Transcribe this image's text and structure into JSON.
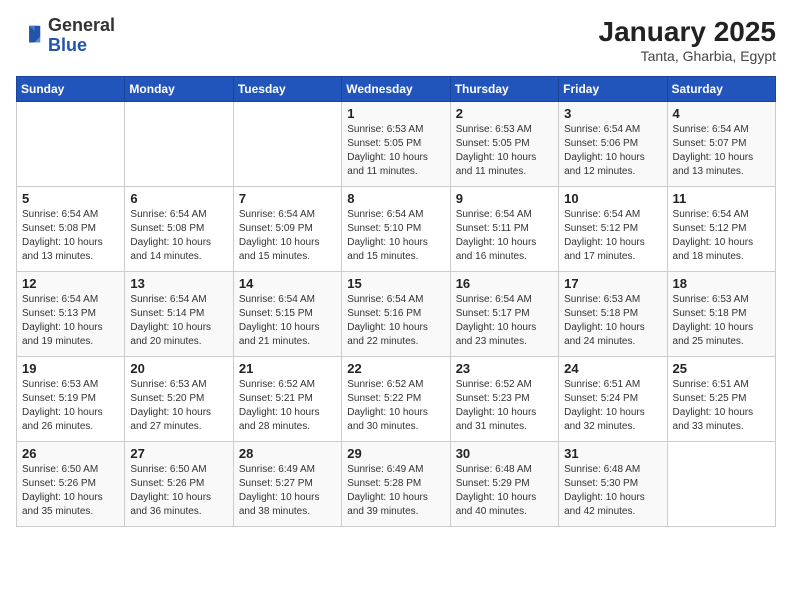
{
  "header": {
    "logo_general": "General",
    "logo_blue": "Blue",
    "month": "January 2025",
    "location": "Tanta, Gharbia, Egypt"
  },
  "days_of_week": [
    "Sunday",
    "Monday",
    "Tuesday",
    "Wednesday",
    "Thursday",
    "Friday",
    "Saturday"
  ],
  "weeks": [
    [
      {
        "day": "",
        "info": ""
      },
      {
        "day": "",
        "info": ""
      },
      {
        "day": "",
        "info": ""
      },
      {
        "day": "1",
        "info": "Sunrise: 6:53 AM\nSunset: 5:05 PM\nDaylight: 10 hours\nand 11 minutes."
      },
      {
        "day": "2",
        "info": "Sunrise: 6:53 AM\nSunset: 5:05 PM\nDaylight: 10 hours\nand 11 minutes."
      },
      {
        "day": "3",
        "info": "Sunrise: 6:54 AM\nSunset: 5:06 PM\nDaylight: 10 hours\nand 12 minutes."
      },
      {
        "day": "4",
        "info": "Sunrise: 6:54 AM\nSunset: 5:07 PM\nDaylight: 10 hours\nand 13 minutes."
      }
    ],
    [
      {
        "day": "5",
        "info": "Sunrise: 6:54 AM\nSunset: 5:08 PM\nDaylight: 10 hours\nand 13 minutes."
      },
      {
        "day": "6",
        "info": "Sunrise: 6:54 AM\nSunset: 5:08 PM\nDaylight: 10 hours\nand 14 minutes."
      },
      {
        "day": "7",
        "info": "Sunrise: 6:54 AM\nSunset: 5:09 PM\nDaylight: 10 hours\nand 15 minutes."
      },
      {
        "day": "8",
        "info": "Sunrise: 6:54 AM\nSunset: 5:10 PM\nDaylight: 10 hours\nand 15 minutes."
      },
      {
        "day": "9",
        "info": "Sunrise: 6:54 AM\nSunset: 5:11 PM\nDaylight: 10 hours\nand 16 minutes."
      },
      {
        "day": "10",
        "info": "Sunrise: 6:54 AM\nSunset: 5:12 PM\nDaylight: 10 hours\nand 17 minutes."
      },
      {
        "day": "11",
        "info": "Sunrise: 6:54 AM\nSunset: 5:12 PM\nDaylight: 10 hours\nand 18 minutes."
      }
    ],
    [
      {
        "day": "12",
        "info": "Sunrise: 6:54 AM\nSunset: 5:13 PM\nDaylight: 10 hours\nand 19 minutes."
      },
      {
        "day": "13",
        "info": "Sunrise: 6:54 AM\nSunset: 5:14 PM\nDaylight: 10 hours\nand 20 minutes."
      },
      {
        "day": "14",
        "info": "Sunrise: 6:54 AM\nSunset: 5:15 PM\nDaylight: 10 hours\nand 21 minutes."
      },
      {
        "day": "15",
        "info": "Sunrise: 6:54 AM\nSunset: 5:16 PM\nDaylight: 10 hours\nand 22 minutes."
      },
      {
        "day": "16",
        "info": "Sunrise: 6:54 AM\nSunset: 5:17 PM\nDaylight: 10 hours\nand 23 minutes."
      },
      {
        "day": "17",
        "info": "Sunrise: 6:53 AM\nSunset: 5:18 PM\nDaylight: 10 hours\nand 24 minutes."
      },
      {
        "day": "18",
        "info": "Sunrise: 6:53 AM\nSunset: 5:18 PM\nDaylight: 10 hours\nand 25 minutes."
      }
    ],
    [
      {
        "day": "19",
        "info": "Sunrise: 6:53 AM\nSunset: 5:19 PM\nDaylight: 10 hours\nand 26 minutes."
      },
      {
        "day": "20",
        "info": "Sunrise: 6:53 AM\nSunset: 5:20 PM\nDaylight: 10 hours\nand 27 minutes."
      },
      {
        "day": "21",
        "info": "Sunrise: 6:52 AM\nSunset: 5:21 PM\nDaylight: 10 hours\nand 28 minutes."
      },
      {
        "day": "22",
        "info": "Sunrise: 6:52 AM\nSunset: 5:22 PM\nDaylight: 10 hours\nand 30 minutes."
      },
      {
        "day": "23",
        "info": "Sunrise: 6:52 AM\nSunset: 5:23 PM\nDaylight: 10 hours\nand 31 minutes."
      },
      {
        "day": "24",
        "info": "Sunrise: 6:51 AM\nSunset: 5:24 PM\nDaylight: 10 hours\nand 32 minutes."
      },
      {
        "day": "25",
        "info": "Sunrise: 6:51 AM\nSunset: 5:25 PM\nDaylight: 10 hours\nand 33 minutes."
      }
    ],
    [
      {
        "day": "26",
        "info": "Sunrise: 6:50 AM\nSunset: 5:26 PM\nDaylight: 10 hours\nand 35 minutes."
      },
      {
        "day": "27",
        "info": "Sunrise: 6:50 AM\nSunset: 5:26 PM\nDaylight: 10 hours\nand 36 minutes."
      },
      {
        "day": "28",
        "info": "Sunrise: 6:49 AM\nSunset: 5:27 PM\nDaylight: 10 hours\nand 38 minutes."
      },
      {
        "day": "29",
        "info": "Sunrise: 6:49 AM\nSunset: 5:28 PM\nDaylight: 10 hours\nand 39 minutes."
      },
      {
        "day": "30",
        "info": "Sunrise: 6:48 AM\nSunset: 5:29 PM\nDaylight: 10 hours\nand 40 minutes."
      },
      {
        "day": "31",
        "info": "Sunrise: 6:48 AM\nSunset: 5:30 PM\nDaylight: 10 hours\nand 42 minutes."
      },
      {
        "day": "",
        "info": ""
      }
    ]
  ]
}
